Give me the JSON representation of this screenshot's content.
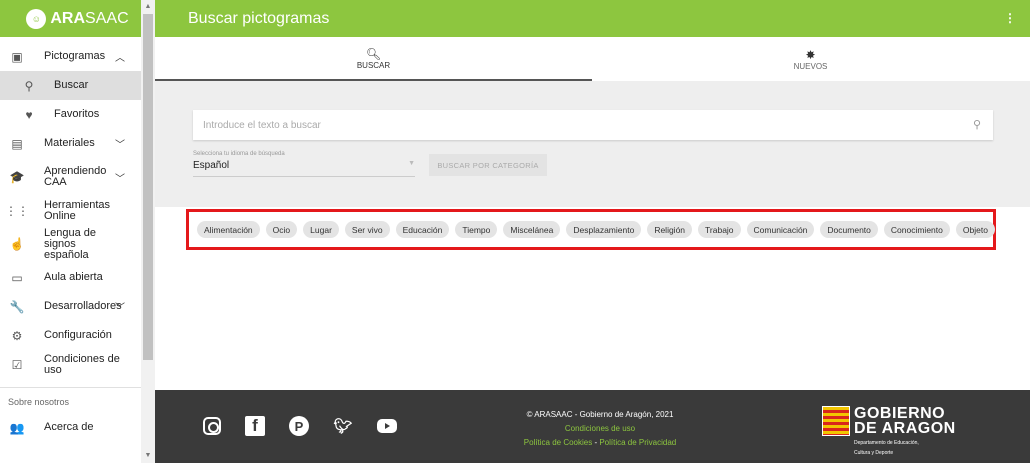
{
  "brand": {
    "name_bold": "ARA",
    "name_rest": "SAAC",
    "logo_text": "☺"
  },
  "header": {
    "title": "Buscar pictogramas"
  },
  "sidebar": {
    "items": [
      {
        "label": "Pictogramas",
        "icon": "image-icon",
        "chevron": "^"
      },
      {
        "label": "Buscar",
        "icon": "search-icon"
      },
      {
        "label": "Favoritos",
        "icon": "heart-icon"
      },
      {
        "label": "Materiales",
        "icon": "book-icon",
        "chevron": "v"
      },
      {
        "label": "Aprendiendo CAA",
        "icon": "school-icon",
        "chevron": "v"
      },
      {
        "label": "Herramientas Online",
        "icon": "grid-icon"
      },
      {
        "label": "Lengua de signos española",
        "icon": "sign-language-icon"
      },
      {
        "label": "Aula abierta",
        "icon": "classroom-icon"
      },
      {
        "label": "Desarrolladores",
        "icon": "wrench-icon",
        "chevron": "v"
      },
      {
        "label": "Configuración",
        "icon": "gear-icon"
      },
      {
        "label": "Condiciones de uso",
        "icon": "checkbox-icon"
      }
    ],
    "caption": "Sobre nosotros",
    "about": {
      "label": "Acerca de",
      "icon": "people-icon"
    }
  },
  "tabs": [
    {
      "label": "BUSCAR",
      "icon": "search-icon",
      "active": true
    },
    {
      "label": "NUEVOS",
      "icon": "new-badge-icon",
      "active": false
    }
  ],
  "search": {
    "placeholder": "Introduce el texto a buscar",
    "value": ""
  },
  "language": {
    "caption": "Selecciona tu idioma de búsqueda",
    "value": "Español"
  },
  "category_button": "BUSCAR POR CATEGORÍA",
  "categories": [
    "Alimentación",
    "Ocio",
    "Lugar",
    "Ser vivo",
    "Educación",
    "Tiempo",
    "Miscelánea",
    "Desplazamiento",
    "Religión",
    "Trabajo",
    "Comunicación",
    "Documento",
    "Conocimiento",
    "Objeto"
  ],
  "footer": {
    "copyright": "© ARASAAC - Gobierno de Aragón, 2021",
    "terms": "Condiciones de uso",
    "cookies": "Política de Cookies",
    "separator": " - ",
    "privacy": "Política de Privacidad",
    "gov_title_1": "GOBIERNO",
    "gov_title_2": "DE ARAGON",
    "gov_sub_1": "Departamento de Educación,",
    "gov_sub_2": "Cultura y Deporte"
  },
  "colors": {
    "accent": "#8dc63f",
    "highlight": "#e4181b",
    "footer": "#3a3a3a"
  }
}
